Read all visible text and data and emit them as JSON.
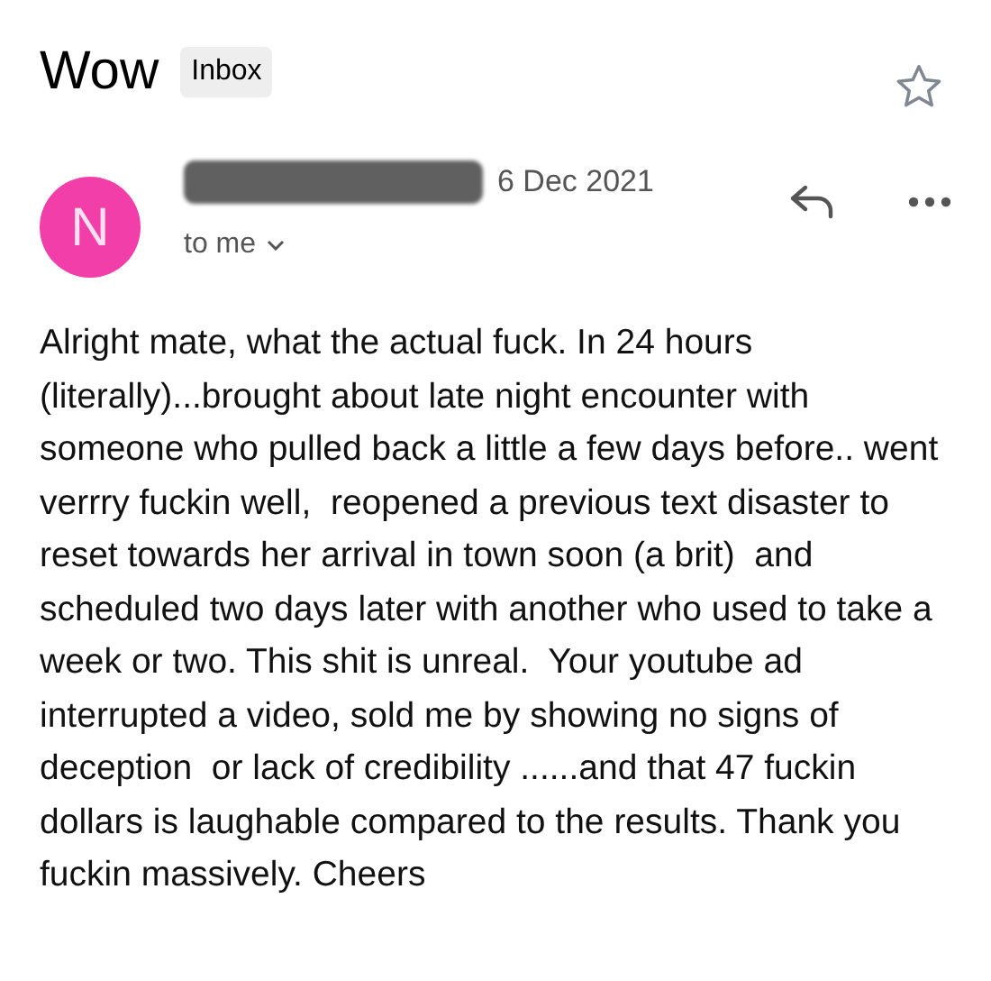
{
  "subject": "Wow",
  "label": "Inbox",
  "starred": false,
  "sender": {
    "initial": "N",
    "date": "6 Dec 2021",
    "recipient": "to me"
  },
  "body": "Alright mate, what the actual fuck. In 24 hours (literally)...brought about late night encounter with someone who pulled back a little a few days before.. went verrry fuckin well,  reopened a previous text disaster to reset towards her arrival in town soon (a brit)  and scheduled two days later with another who used to take a week or two. This shit is unreal.  Your youtube ad interrupted a video, sold me by showing no signs of deception  or lack of credibility ......and that 47 fuckin dollars is laughable compared to the results. Thank you fuckin massively. Cheers"
}
